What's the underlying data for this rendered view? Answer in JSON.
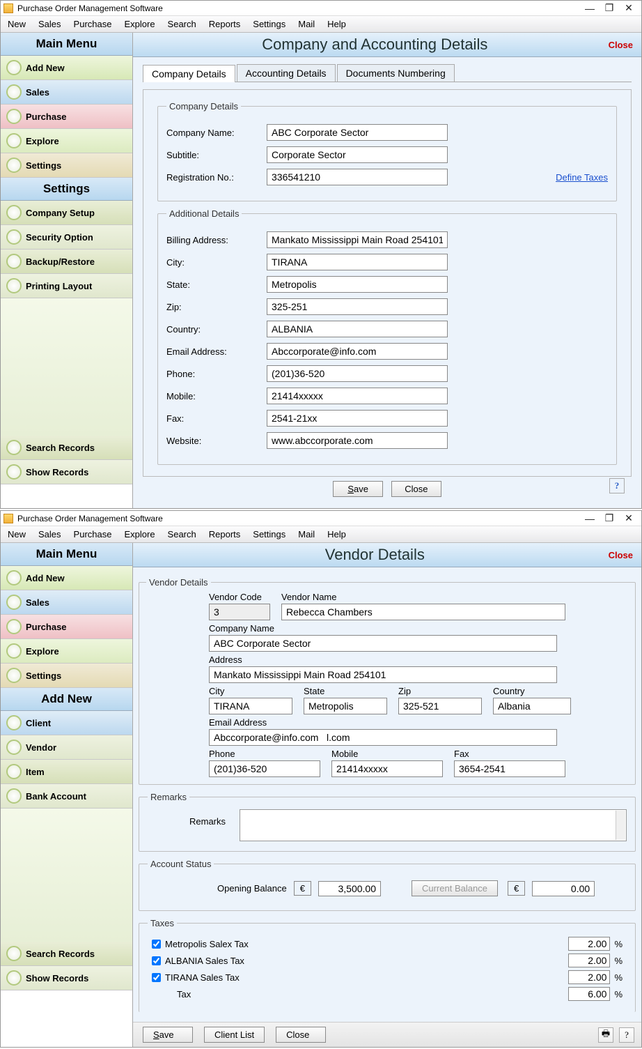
{
  "app_title": "Purchase Order Management Software",
  "menubar": [
    "New",
    "Sales",
    "Purchase",
    "Explore",
    "Search",
    "Reports",
    "Settings",
    "Mail",
    "Help"
  ],
  "sidebar": {
    "main_menu_header": "Main Menu",
    "main_items": [
      "Add New",
      "Sales",
      "Purchase",
      "Explore",
      "Settings"
    ],
    "settings_header": "Settings",
    "settings_items": [
      "Company Setup",
      "Security Option",
      "Backup/Restore",
      "Printing Layout"
    ],
    "bottom_items": [
      "Search Records",
      "Show Records"
    ],
    "addnew_header": "Add New",
    "addnew_items": [
      "Client",
      "Vendor",
      "Item",
      "Bank Account"
    ]
  },
  "panel1": {
    "title": "Company and Accounting Details",
    "close": "Close",
    "tabs": [
      "Company Details",
      "Accounting Details",
      "Documents Numbering"
    ],
    "company_legend": "Company Details",
    "company": {
      "labels": {
        "name": "Company Name:",
        "subtitle": "Subtitle:",
        "reg": "Registration No.:"
      },
      "name": "ABC Corporate Sector",
      "subtitle": "Corporate Sector",
      "reg": "336541210"
    },
    "define_taxes": "Define Taxes",
    "additional_legend": "Additional Details",
    "addl": {
      "labels": {
        "billing": "Billing Address:",
        "city": "City:",
        "state": "State:",
        "zip": "Zip:",
        "country": "Country:",
        "email": "Email Address:",
        "phone": "Phone:",
        "mobile": "Mobile:",
        "fax": "Fax:",
        "website": "Website:"
      },
      "billing": "Mankato Mississippi Main Road 254101",
      "city": "TIRANA",
      "state": "Metropolis",
      "zip": "325-251",
      "country": "ALBANIA",
      "email": "Abccorporate@info.com",
      "phone": "(201)36-520",
      "mobile": "21414xxxxx",
      "fax": "2541-21xx",
      "website": "www.abccorporate.com"
    },
    "save_btn": "Save",
    "close_btn": "Close"
  },
  "panel2": {
    "title": "Vendor Details",
    "close": "Close",
    "vendor_legend": "Vendor Details",
    "labels": {
      "code": "Vendor Code",
      "name": "Vendor Name",
      "company": "Company Name",
      "address": "Address",
      "city": "City",
      "state": "State",
      "zip": "Zip",
      "country": "Country",
      "email": "Email Address",
      "phone": "Phone",
      "mobile": "Mobile",
      "fax": "Fax"
    },
    "vendor": {
      "code": "3",
      "name": "Rebecca Chambers",
      "company": "ABC Corporate Sector",
      "address": "Mankato Mississippi Main Road 254101",
      "city": "TIRANA",
      "state": "Metropolis",
      "zip": "325-521",
      "country": "Albania",
      "email": "Abccorporate@info.com   l.com",
      "phone": "(201)36-520",
      "mobile": "21414xxxxx",
      "fax": "3654-2541"
    },
    "remarks_legend": "Remarks",
    "remarks_label": "Remarks",
    "account_legend": "Account Status",
    "opening_label": "Opening Balance",
    "opening_cur": "€",
    "opening_val": "3,500.00",
    "current_label": "Current Balance",
    "current_cur": "€",
    "current_val": "0.00",
    "taxes_legend": "Taxes",
    "taxes": [
      {
        "name": "Metropolis Salex Tax",
        "val": "2.00"
      },
      {
        "name": "ALBANIA Sales Tax",
        "val": "2.00"
      },
      {
        "name": "TIRANA Sales Tax",
        "val": "2.00"
      }
    ],
    "tax_total_label": "Tax",
    "tax_total": "6.00",
    "save_btn": "Save",
    "client_list_btn": "Client List",
    "close_btn": "Close"
  }
}
